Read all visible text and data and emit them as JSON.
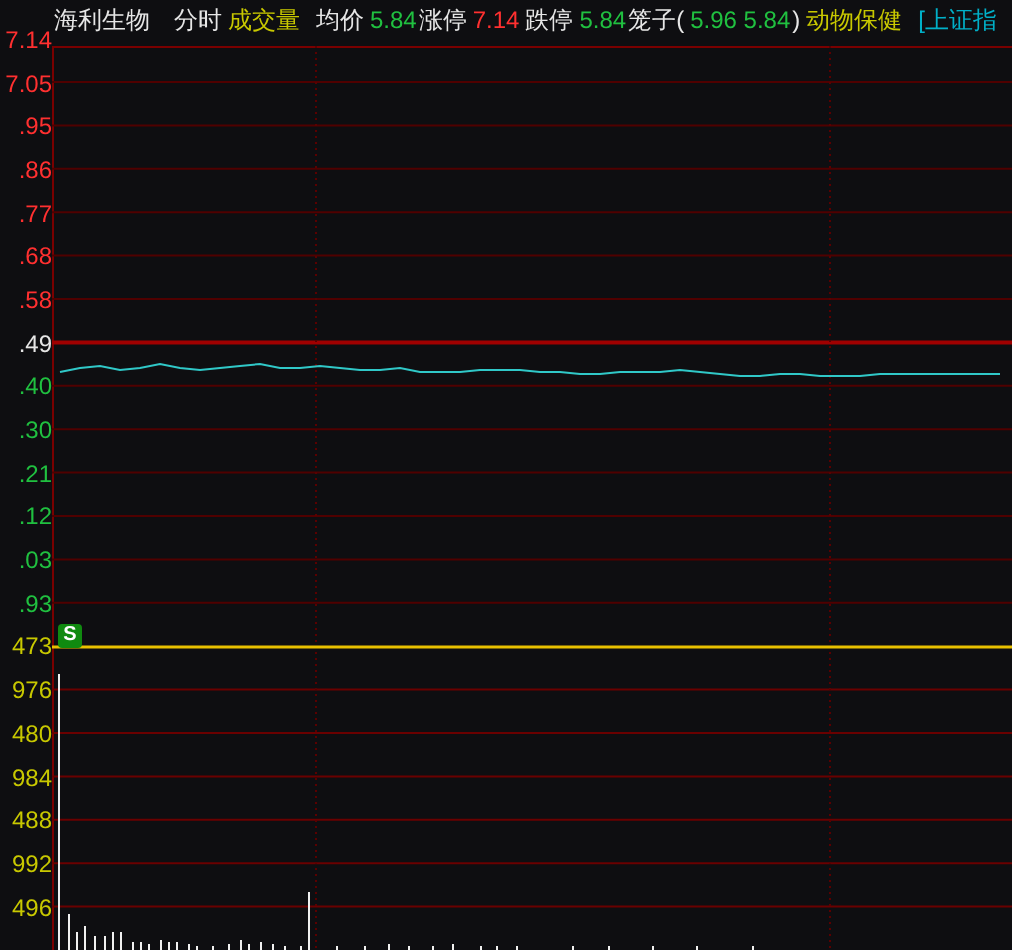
{
  "header": [
    {
      "text": "海利生物",
      "kind": "name"
    },
    {
      "text": "分时",
      "kind": "label"
    },
    {
      "text": "成交量",
      "kind": "sector"
    },
    {
      "text": "均价",
      "kind": "label"
    },
    {
      "text": "5.84",
      "kind": "down"
    },
    {
      "text": "涨停",
      "kind": "label"
    },
    {
      "text": "7.14",
      "kind": "up"
    },
    {
      "text": "跌停",
      "kind": "label"
    },
    {
      "text": "5.84",
      "kind": "down"
    },
    {
      "text": "笼子(",
      "kind": "label"
    },
    {
      "text": "5.96 5.84",
      "kind": "down"
    },
    {
      "text": ")",
      "kind": "label"
    },
    {
      "text": "动物保健",
      "kind": "sector"
    },
    {
      "text": "[上证指",
      "kind": "index"
    }
  ],
  "axis": [
    {
      "text": "7.14",
      "kind": "up"
    },
    {
      "text": "7.05",
      "kind": "up"
    },
    {
      "text": ".95",
      "kind": "up"
    },
    {
      "text": ".86",
      "kind": "up"
    },
    {
      "text": ".77",
      "kind": "up"
    },
    {
      "text": ".68",
      "kind": "up"
    },
    {
      "text": ".58",
      "kind": "up"
    },
    {
      "text": ".49",
      "kind": "flat"
    },
    {
      "text": ".40",
      "kind": "down"
    },
    {
      "text": ".30",
      "kind": "down"
    },
    {
      "text": ".21",
      "kind": "down"
    },
    {
      "text": ".12",
      "kind": "down"
    },
    {
      "text": ".03",
      "kind": "down"
    },
    {
      "text": ".93",
      "kind": "down"
    },
    {
      "text": "473",
      "kind": "volume"
    },
    {
      "text": "976",
      "kind": "volume"
    },
    {
      "text": "480",
      "kind": "volume"
    },
    {
      "text": "984",
      "kind": "volume"
    },
    {
      "text": "488",
      "kind": "volume"
    },
    {
      "text": "992",
      "kind": "volume"
    },
    {
      "text": "496",
      "kind": "volume"
    }
  ],
  "signal_badge": "S"
}
